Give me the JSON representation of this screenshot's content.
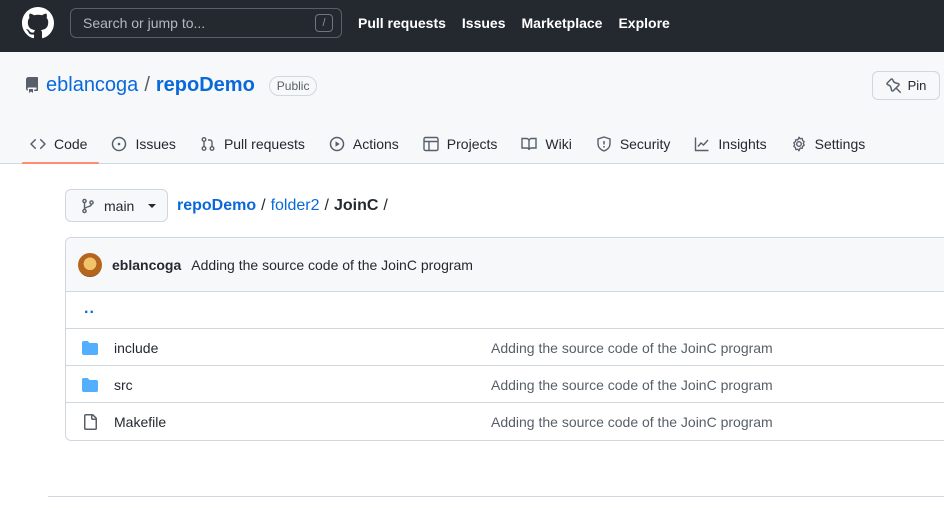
{
  "header": {
    "search_placeholder": "Search or jump to...",
    "search_shortcut": "/",
    "nav": [
      "Pull requests",
      "Issues",
      "Marketplace",
      "Explore"
    ]
  },
  "repo": {
    "owner": "eblancoga",
    "separator": "/",
    "name": "repoDemo",
    "visibility": "Public",
    "pin_label": "Pin"
  },
  "tabs": [
    {
      "label": "Code",
      "icon": "code-icon",
      "active": true
    },
    {
      "label": "Issues",
      "icon": "issue-icon"
    },
    {
      "label": "Pull requests",
      "icon": "pull-request-icon"
    },
    {
      "label": "Actions",
      "icon": "play-icon"
    },
    {
      "label": "Projects",
      "icon": "table-icon"
    },
    {
      "label": "Wiki",
      "icon": "book-icon"
    },
    {
      "label": "Security",
      "icon": "shield-icon"
    },
    {
      "label": "Insights",
      "icon": "graph-icon"
    },
    {
      "label": "Settings",
      "icon": "gear-icon"
    }
  ],
  "branch": {
    "name": "main"
  },
  "breadcrumb": {
    "root": "repoDemo",
    "folder": "folder2",
    "current": "JoinC",
    "sep": "/"
  },
  "commit": {
    "author": "eblancoga",
    "message": "Adding the source code of the JoinC program"
  },
  "files": {
    "parent": "..",
    "rows": [
      {
        "name": "include",
        "type": "folder",
        "message": "Adding the source code of the JoinC program"
      },
      {
        "name": "src",
        "type": "folder",
        "message": "Adding the source code of the JoinC program"
      },
      {
        "name": "Makefile",
        "type": "file",
        "message": "Adding the source code of the JoinC program"
      }
    ]
  },
  "colors": {
    "accent": "#0969da",
    "header_bg": "#24292f",
    "active_tab": "#fd8c73",
    "folder": "#54aeff"
  }
}
